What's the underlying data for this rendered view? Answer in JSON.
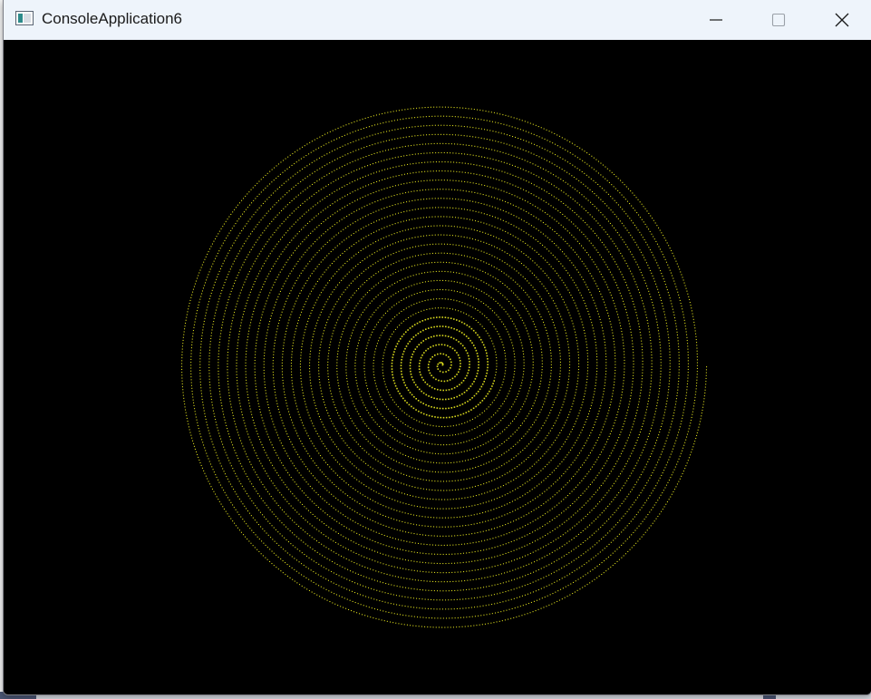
{
  "window": {
    "title": "ConsoleApplication6",
    "icon": "console-app-icon",
    "controls": {
      "minimize_icon": "minimize-icon",
      "maximize_icon": "maximize-icon",
      "close_icon": "close-icon"
    }
  },
  "canvas": {
    "background": "#000000",
    "spiral_color": "#d8d81c",
    "turns": 29
  }
}
